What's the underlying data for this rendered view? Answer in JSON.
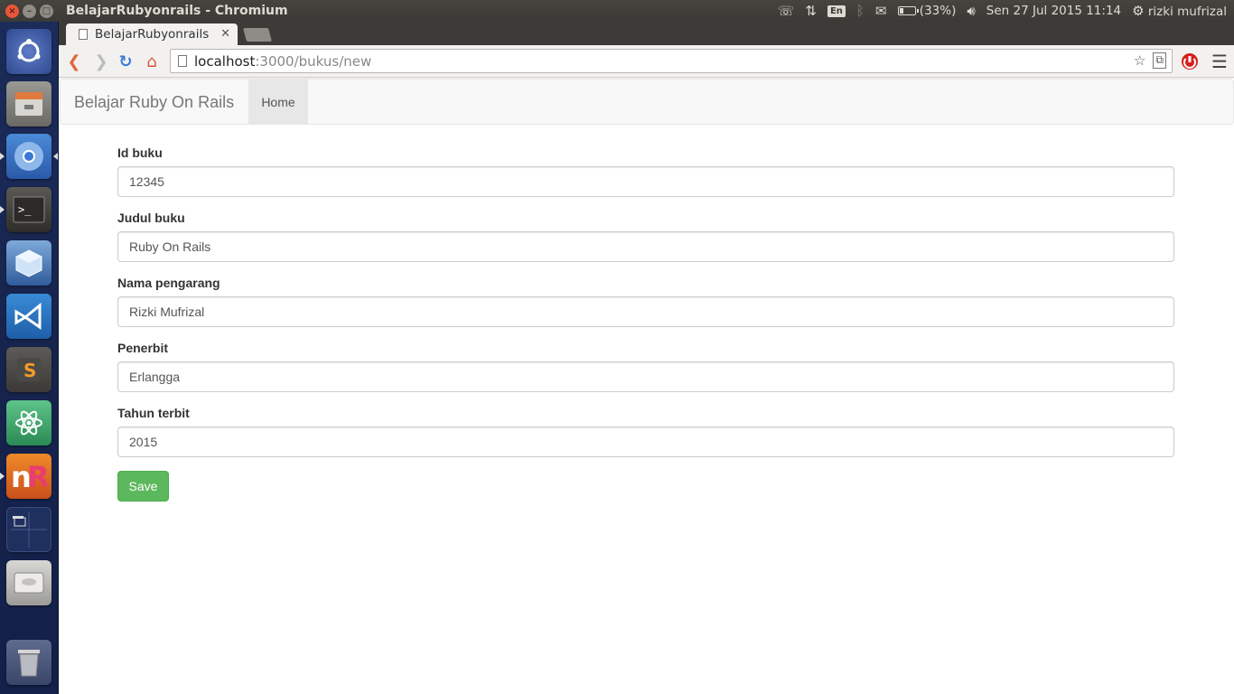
{
  "system_panel": {
    "window_title": "BelajarRubyonrails - Chromium",
    "keyboard_layout": "En",
    "battery_percent": "(33%)",
    "battery_level": 0.33,
    "datetime": "Sen 27 Jul 2015 11:14",
    "username": "rizki mufrizal"
  },
  "launcher": {
    "items": [
      "ubuntu-dash",
      "files",
      "chromium",
      "terminal",
      "virtualbox",
      "visual-studio-code",
      "sublime-text",
      "atom",
      "rubymine",
      "workspace-switcher",
      "disk",
      "trash"
    ]
  },
  "browser": {
    "tab_title": "BelajarRubyonrails",
    "url_host": "localhost",
    "url_path": ":3000/bukus/new"
  },
  "navbar": {
    "brand": "Belajar Ruby On Rails",
    "home": "Home"
  },
  "form": {
    "fields": [
      {
        "label": "Id buku",
        "value": "12345"
      },
      {
        "label": "Judul buku",
        "value": "Ruby On Rails"
      },
      {
        "label": "Nama pengarang",
        "value": "Rizki Mufrizal"
      },
      {
        "label": "Penerbit",
        "value": "Erlangga"
      },
      {
        "label": "Tahun terbit",
        "value": "2015"
      }
    ],
    "submit_label": "Save"
  },
  "colors": {
    "save_button": "#5cb85c",
    "launcher_bg": "#1c2c5a",
    "close_button": "#e9553a"
  }
}
